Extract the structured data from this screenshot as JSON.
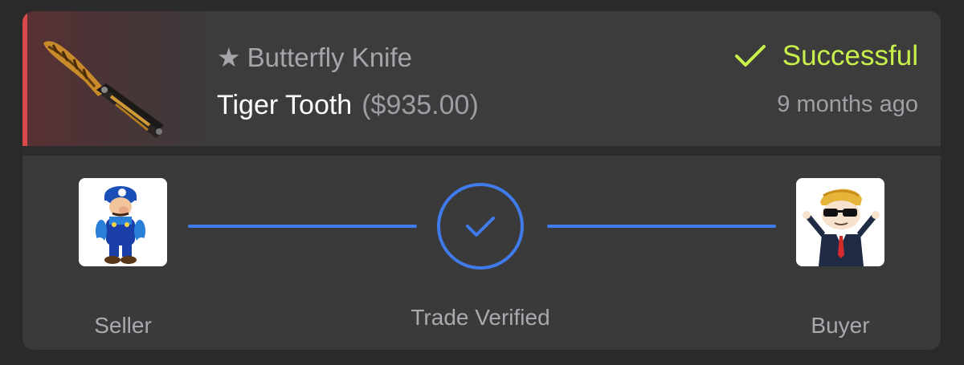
{
  "item": {
    "star": "★",
    "name": "Butterfly Knife",
    "skin": "Tiger Tooth",
    "price": "($935.00)",
    "rarity_color": "#d94a4a",
    "image_icon": "butterfly-knife-icon"
  },
  "status": {
    "label": "Successful",
    "icon": "checkmark-icon",
    "color": "#c7f04a",
    "time_ago": "9 months ago"
  },
  "trade": {
    "seller_label": "Seller",
    "buyer_label": "Buyer",
    "verified_label": "Trade Verified",
    "seller_avatar": "luigi-avatar",
    "buyer_avatar": "wsb-guy-avatar",
    "accent_color": "#3f7bea"
  }
}
